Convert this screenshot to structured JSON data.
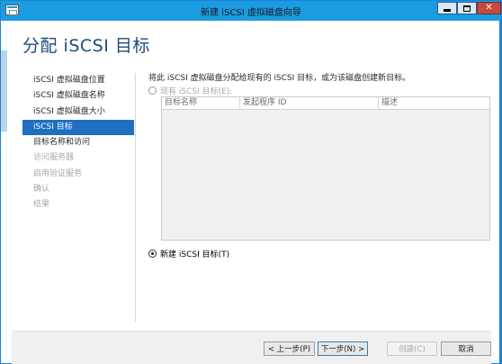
{
  "window": {
    "title": "新建 iSCSI 虚拟磁盘向导"
  },
  "page": {
    "title": "分配 iSCSI 目标"
  },
  "nav": {
    "items": [
      {
        "label": "iSCSI 虚拟磁盘位置",
        "state": "normal"
      },
      {
        "label": "iSCSI 虚拟磁盘名称",
        "state": "normal"
      },
      {
        "label": "iSCSI 虚拟磁盘大小",
        "state": "normal"
      },
      {
        "label": "iSCSI 目标",
        "state": "active"
      },
      {
        "label": "目标名称和访问",
        "state": "normal"
      },
      {
        "label": "访问服务器",
        "state": "disabled"
      },
      {
        "label": "启用验证服务",
        "state": "disabled"
      },
      {
        "label": "确认",
        "state": "disabled"
      },
      {
        "label": "结果",
        "state": "disabled"
      }
    ]
  },
  "content": {
    "description": "将此 iSCSI 虚拟磁盘分配给现有的 iSCSI 目标，或为该磁盘创建新目标。",
    "existing_target_label": "现有 iSCSI 目标(E):",
    "existing_target_selected": false,
    "table": {
      "columns": [
        "目标名称",
        "发起程序 ID",
        "描述"
      ],
      "rows": []
    },
    "new_target_label": "新建 iSCSI 目标(T)",
    "new_target_selected": true
  },
  "buttons": {
    "prev": "< 上一步(P)",
    "next": "下一步(N) >",
    "create": "创建(C)",
    "cancel": "取消"
  },
  "colors": {
    "titlebar": "#1b9be0",
    "active_nav": "#1e6fc2",
    "page_title": "#1f4b7a",
    "close_button": "#c74a3e"
  }
}
